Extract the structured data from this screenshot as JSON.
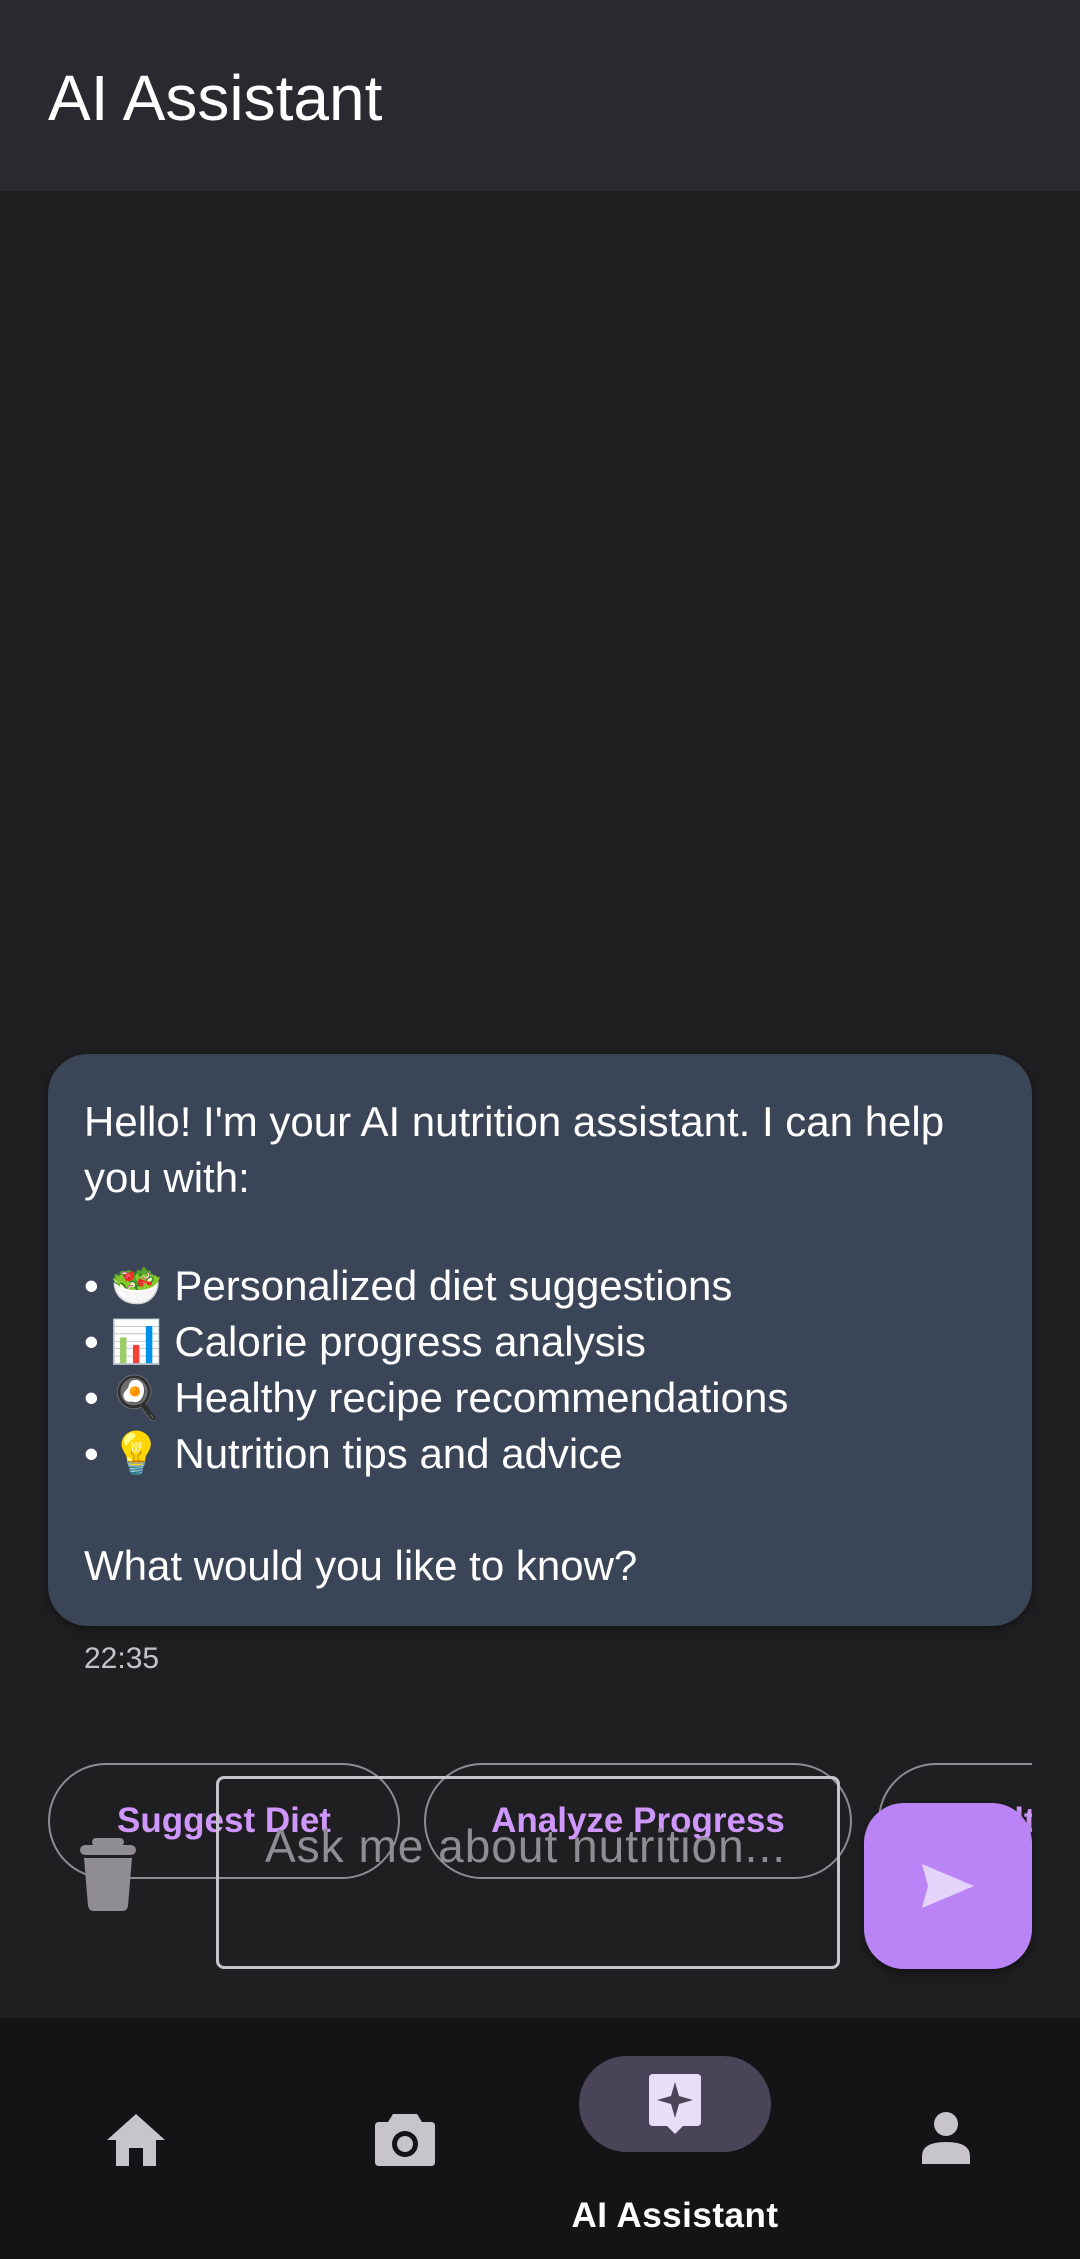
{
  "app_bar": {
    "title": "AI Assistant"
  },
  "chat": {
    "message": {
      "intro": "Hello! I'm your AI nutrition assistant. I can help you with:",
      "items": [
        {
          "bullet": "•",
          "emoji": "🥗",
          "text": "Personalized diet suggestions"
        },
        {
          "bullet": "•",
          "emoji": "📊",
          "text": "Calorie progress analysis"
        },
        {
          "bullet": "•",
          "emoji": "🍳",
          "text": "Healthy recipe recommendations"
        },
        {
          "bullet": "•",
          "emoji": "💡",
          "text": "Nutrition tips and advice"
        }
      ],
      "closing": "What would you like to know?",
      "timestamp": "22:35"
    }
  },
  "quick_actions": [
    {
      "label": "Suggest Diet"
    },
    {
      "label": "Analyze Progress"
    },
    {
      "label": "Healt"
    }
  ],
  "composer": {
    "placeholder": "Ask me about nutrition...",
    "trash_icon": "trash-icon",
    "send_icon": "send-icon"
  },
  "bottom_nav": {
    "items": [
      {
        "icon": "home-icon",
        "label": ""
      },
      {
        "icon": "camera-icon",
        "label": ""
      },
      {
        "icon": "ai-sparkle-icon",
        "label": "AI Assistant",
        "selected": true
      },
      {
        "icon": "person-icon",
        "label": ""
      }
    ]
  },
  "colors": {
    "app_bar_bg": "#2b2930",
    "background": "#1f1f21",
    "bubble_bg": "#3b4558",
    "accent": "#bb84f6",
    "chip_text": "#cf97fb",
    "nav_bg": "#141416",
    "nav_indicator": "#4a4458"
  }
}
